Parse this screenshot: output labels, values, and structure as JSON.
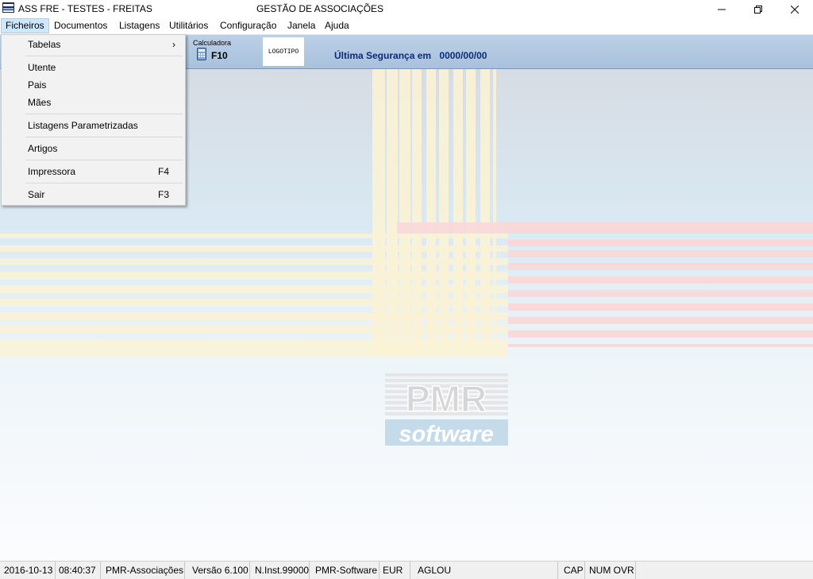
{
  "window": {
    "title_left": "ASS FRE - TESTES - FREITAS",
    "title_center": "GESTÃO DE ASSOCIAÇÕES"
  },
  "menubar": {
    "items": [
      {
        "label": "Ficheiros"
      },
      {
        "label": "Documentos"
      },
      {
        "label": "Listagens"
      },
      {
        "label": "Utilitários"
      },
      {
        "label": "Configuração"
      },
      {
        "label": "Janela"
      },
      {
        "label": "Ajuda"
      }
    ]
  },
  "dropdown": {
    "items": [
      {
        "label": "Tabelas",
        "submenu_arrow": "›"
      },
      {
        "label": "Utente"
      },
      {
        "label": "Pais"
      },
      {
        "label": "Mães"
      },
      {
        "label": "Listagens Parametrizadas"
      },
      {
        "label": "Artigos"
      },
      {
        "label": "Impressora",
        "accel": "F4"
      },
      {
        "label": "Sair",
        "accel": "F3"
      }
    ]
  },
  "toolbar": {
    "calc_label": "Calculadora",
    "calc_key": "F10",
    "logo_text": "LOGOTIPO",
    "security_label": "Última Segurança em",
    "security_date": "0000/00/00"
  },
  "watermark": {
    "brand_top": "PMR",
    "brand_bottom": "software"
  },
  "statusbar": {
    "date": "2016-10-13",
    "time": "08:40:37",
    "product": "PMR-Associações",
    "version": "Versão  6.100",
    "install": "N.Inst.99000",
    "vendor": "PMR-Software",
    "currency": "EUR",
    "user": "AGLOU",
    "cap": "CAP",
    "num_ovr": "NUM OVR"
  },
  "colors": {
    "menu_active_bg": "#cce8ff",
    "toolbar_bg": "#a9c1dc",
    "security_text": "#0a2a7a",
    "watermark_yellow": "#fbf3d6",
    "watermark_red": "#f9d9d9",
    "watermark_blue": "#c5dbe9"
  }
}
